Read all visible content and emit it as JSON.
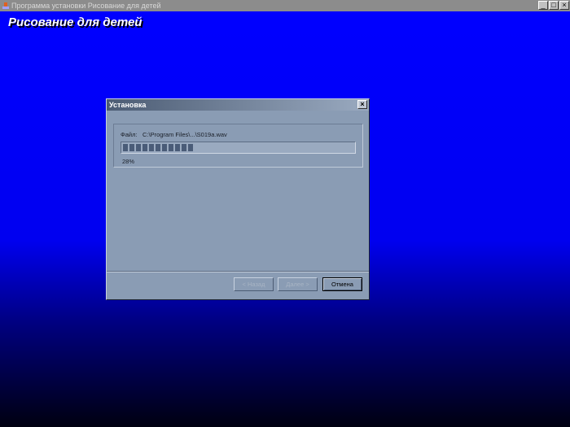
{
  "window": {
    "title": "Программа установки Рисование для детей",
    "minimize": "_",
    "maximize": "□",
    "close": "×"
  },
  "heading": "Рисование для детей",
  "dialog": {
    "title": "Установка",
    "close": "×",
    "file_label": "Файл:",
    "file_value": "C:\\Program Files\\...\\S019a.wav",
    "progress_percent": 28,
    "progress_text": "28%",
    "buttons": {
      "back": "< Назад",
      "next": "Далее >",
      "cancel": "Отмена"
    }
  }
}
